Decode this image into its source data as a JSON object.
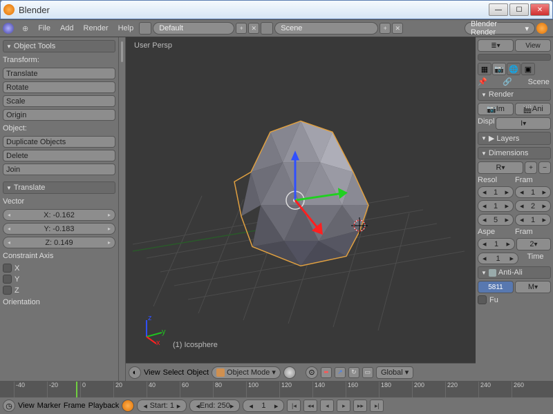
{
  "window": {
    "title": "Blender"
  },
  "menu": {
    "items": [
      "File",
      "Add",
      "Render",
      "Help"
    ],
    "layout": "Default",
    "scene": "Scene",
    "engine": "Blender Render"
  },
  "tools": {
    "header1": "Object Tools",
    "transform_label": "Transform:",
    "translate": "Translate",
    "rotate": "Rotate",
    "scale": "Scale",
    "origin": "Origin",
    "object_label": "Object:",
    "duplicate": "Duplicate Objects",
    "delete": "Delete",
    "join": "Join",
    "header2": "Translate",
    "vector_label": "Vector",
    "vx": "X: -0.162",
    "vy": "Y: -0.183",
    "vz": "Z: 0.149",
    "constraint_label": "Constraint Axis",
    "cx": "X",
    "cy": "Y",
    "cz": "Z",
    "orientation": "Orientation"
  },
  "viewport": {
    "perspective": "User Persp",
    "object": "(1) Icosphere",
    "view": "View",
    "select": "Select",
    "object_menu": "Object",
    "mode": "Object Mode",
    "orientation": "Global"
  },
  "right": {
    "view_label": "View",
    "scene": "Scene",
    "render_header": "Render",
    "image": "Im",
    "anim": "Ani",
    "display": "Displ",
    "display_mode": "I",
    "layers_header": "Layers",
    "dimensions_header": "Dimensions",
    "preset": "R",
    "resol": "Resol",
    "fram": "Fram",
    "r1a": "1",
    "r1b": "1",
    "r2a": "1",
    "r2b": "2",
    "r3a": "5",
    "r3b": "1",
    "aspe": "Aspe",
    "fram2": "Fram",
    "a1": "1",
    "a2": "2",
    "time": "Time",
    "antialias": "Anti-Ali",
    "aa_val": "5811",
    "aa_m": "M",
    "fu": "Fu"
  },
  "timeline": {
    "marks": [
      "-40",
      "-20",
      "0",
      "20",
      "40",
      "60",
      "80",
      "100",
      "120",
      "140",
      "160",
      "180",
      "200",
      "220",
      "240",
      "260"
    ],
    "view": "View",
    "marker": "Marker",
    "frame": "Frame",
    "playback": "Playback",
    "start": "Start: 1",
    "end": "End: 250",
    "current": "1"
  }
}
